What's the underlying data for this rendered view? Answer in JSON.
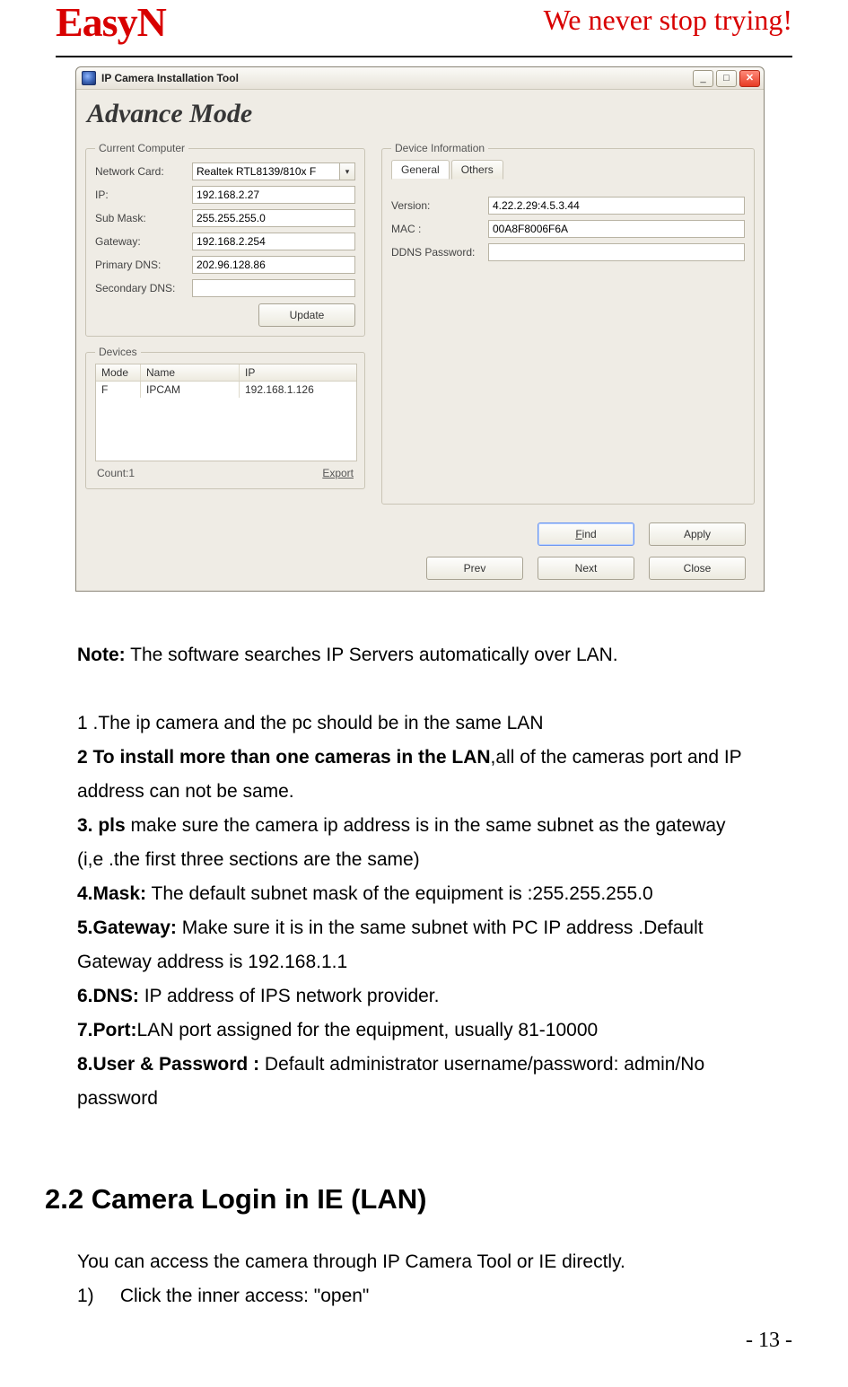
{
  "header": {
    "logo": "EasyN",
    "slogan": "We never stop trying!"
  },
  "app": {
    "title": "IP Camera Installation Tool",
    "mode_heading": "Advance Mode",
    "groups": {
      "current_computer": {
        "legend": "Current Computer",
        "labels": {
          "network_card": "Network Card:",
          "ip": "IP:",
          "sub_mask": "Sub Mask:",
          "gateway": "Gateway:",
          "primary_dns": "Primary DNS:",
          "secondary_dns": "Secondary DNS:"
        },
        "values": {
          "network_card": "Realtek RTL8139/810x F",
          "ip": "192.168.2.27",
          "sub_mask": "255.255.255.0",
          "gateway": "192.168.2.254",
          "primary_dns": "202.96.128.86",
          "secondary_dns": ""
        },
        "update_btn": "Update"
      },
      "devices": {
        "legend": "Devices",
        "columns": {
          "mode": "Mode",
          "name": "Name",
          "ip": "IP"
        },
        "rows": [
          {
            "mode": "F",
            "name": "IPCAM",
            "ip": "192.168.1.126"
          }
        ],
        "count_label": "Count:1",
        "export_link": "Export"
      },
      "device_info": {
        "legend": "Device Information",
        "tabs": {
          "general": "General",
          "others": "Others"
        },
        "labels": {
          "version": "Version:",
          "mac": "MAC   :",
          "ddns": "DDNS Password:"
        },
        "values": {
          "version": "4.22.2.29:4.5.3.44",
          "mac": "00A8F8006F6A",
          "ddns": ""
        }
      }
    },
    "buttons": {
      "find": "Find",
      "apply": "Apply",
      "prev": "Prev",
      "next": "Next",
      "close": "Close"
    }
  },
  "notes": {
    "note_line": "Note: The software searches IP Servers automatically over LAN.",
    "note_prefix": "Note:",
    "note_rest": " The software searches IP Servers automatically over LAN.",
    "items": [
      {
        "html_lead": "1 .",
        "lead_bold": false,
        "rest": "The ip camera and the pc should be in the same LAN"
      },
      {
        "html_lead": "2 To install more than one cameras in the LAN",
        "lead_bold": true,
        "rest": ",all of the cameras port and IP address can not be same."
      },
      {
        "html_lead": "3. pls",
        "lead_bold": true,
        "rest": " make sure the camera ip address is in the same subnet as the gateway (i,e .the first three sections are the same)"
      },
      {
        "html_lead": "4.Mask:",
        "lead_bold": true,
        "rest": " The default subnet mask of the equipment is :255.255.255.0"
      },
      {
        "html_lead": "5.Gateway:",
        "lead_bold": true,
        "rest": " Make sure it is in the same subnet with PC IP address .Default Gateway address is 192.168.1.1"
      },
      {
        "html_lead": "6.DNS:",
        "lead_bold": true,
        "rest": " IP address of IPS network provider."
      },
      {
        "html_lead": "7.Port:",
        "lead_bold": true,
        "rest": "LAN port assigned for the equipment, usually 81-10000"
      },
      {
        "html_lead": "8.User & Password :",
        "lead_bold": true,
        "rest": " Default administrator username/password: admin/No password"
      }
    ]
  },
  "section": {
    "heading": "2.2 Camera Login in IE (LAN)",
    "intro": "You can access the camera through IP Camera Tool or IE directly.",
    "bullet": "1)     Click the inner access: \"open\""
  },
  "page_num": "- 13 -"
}
